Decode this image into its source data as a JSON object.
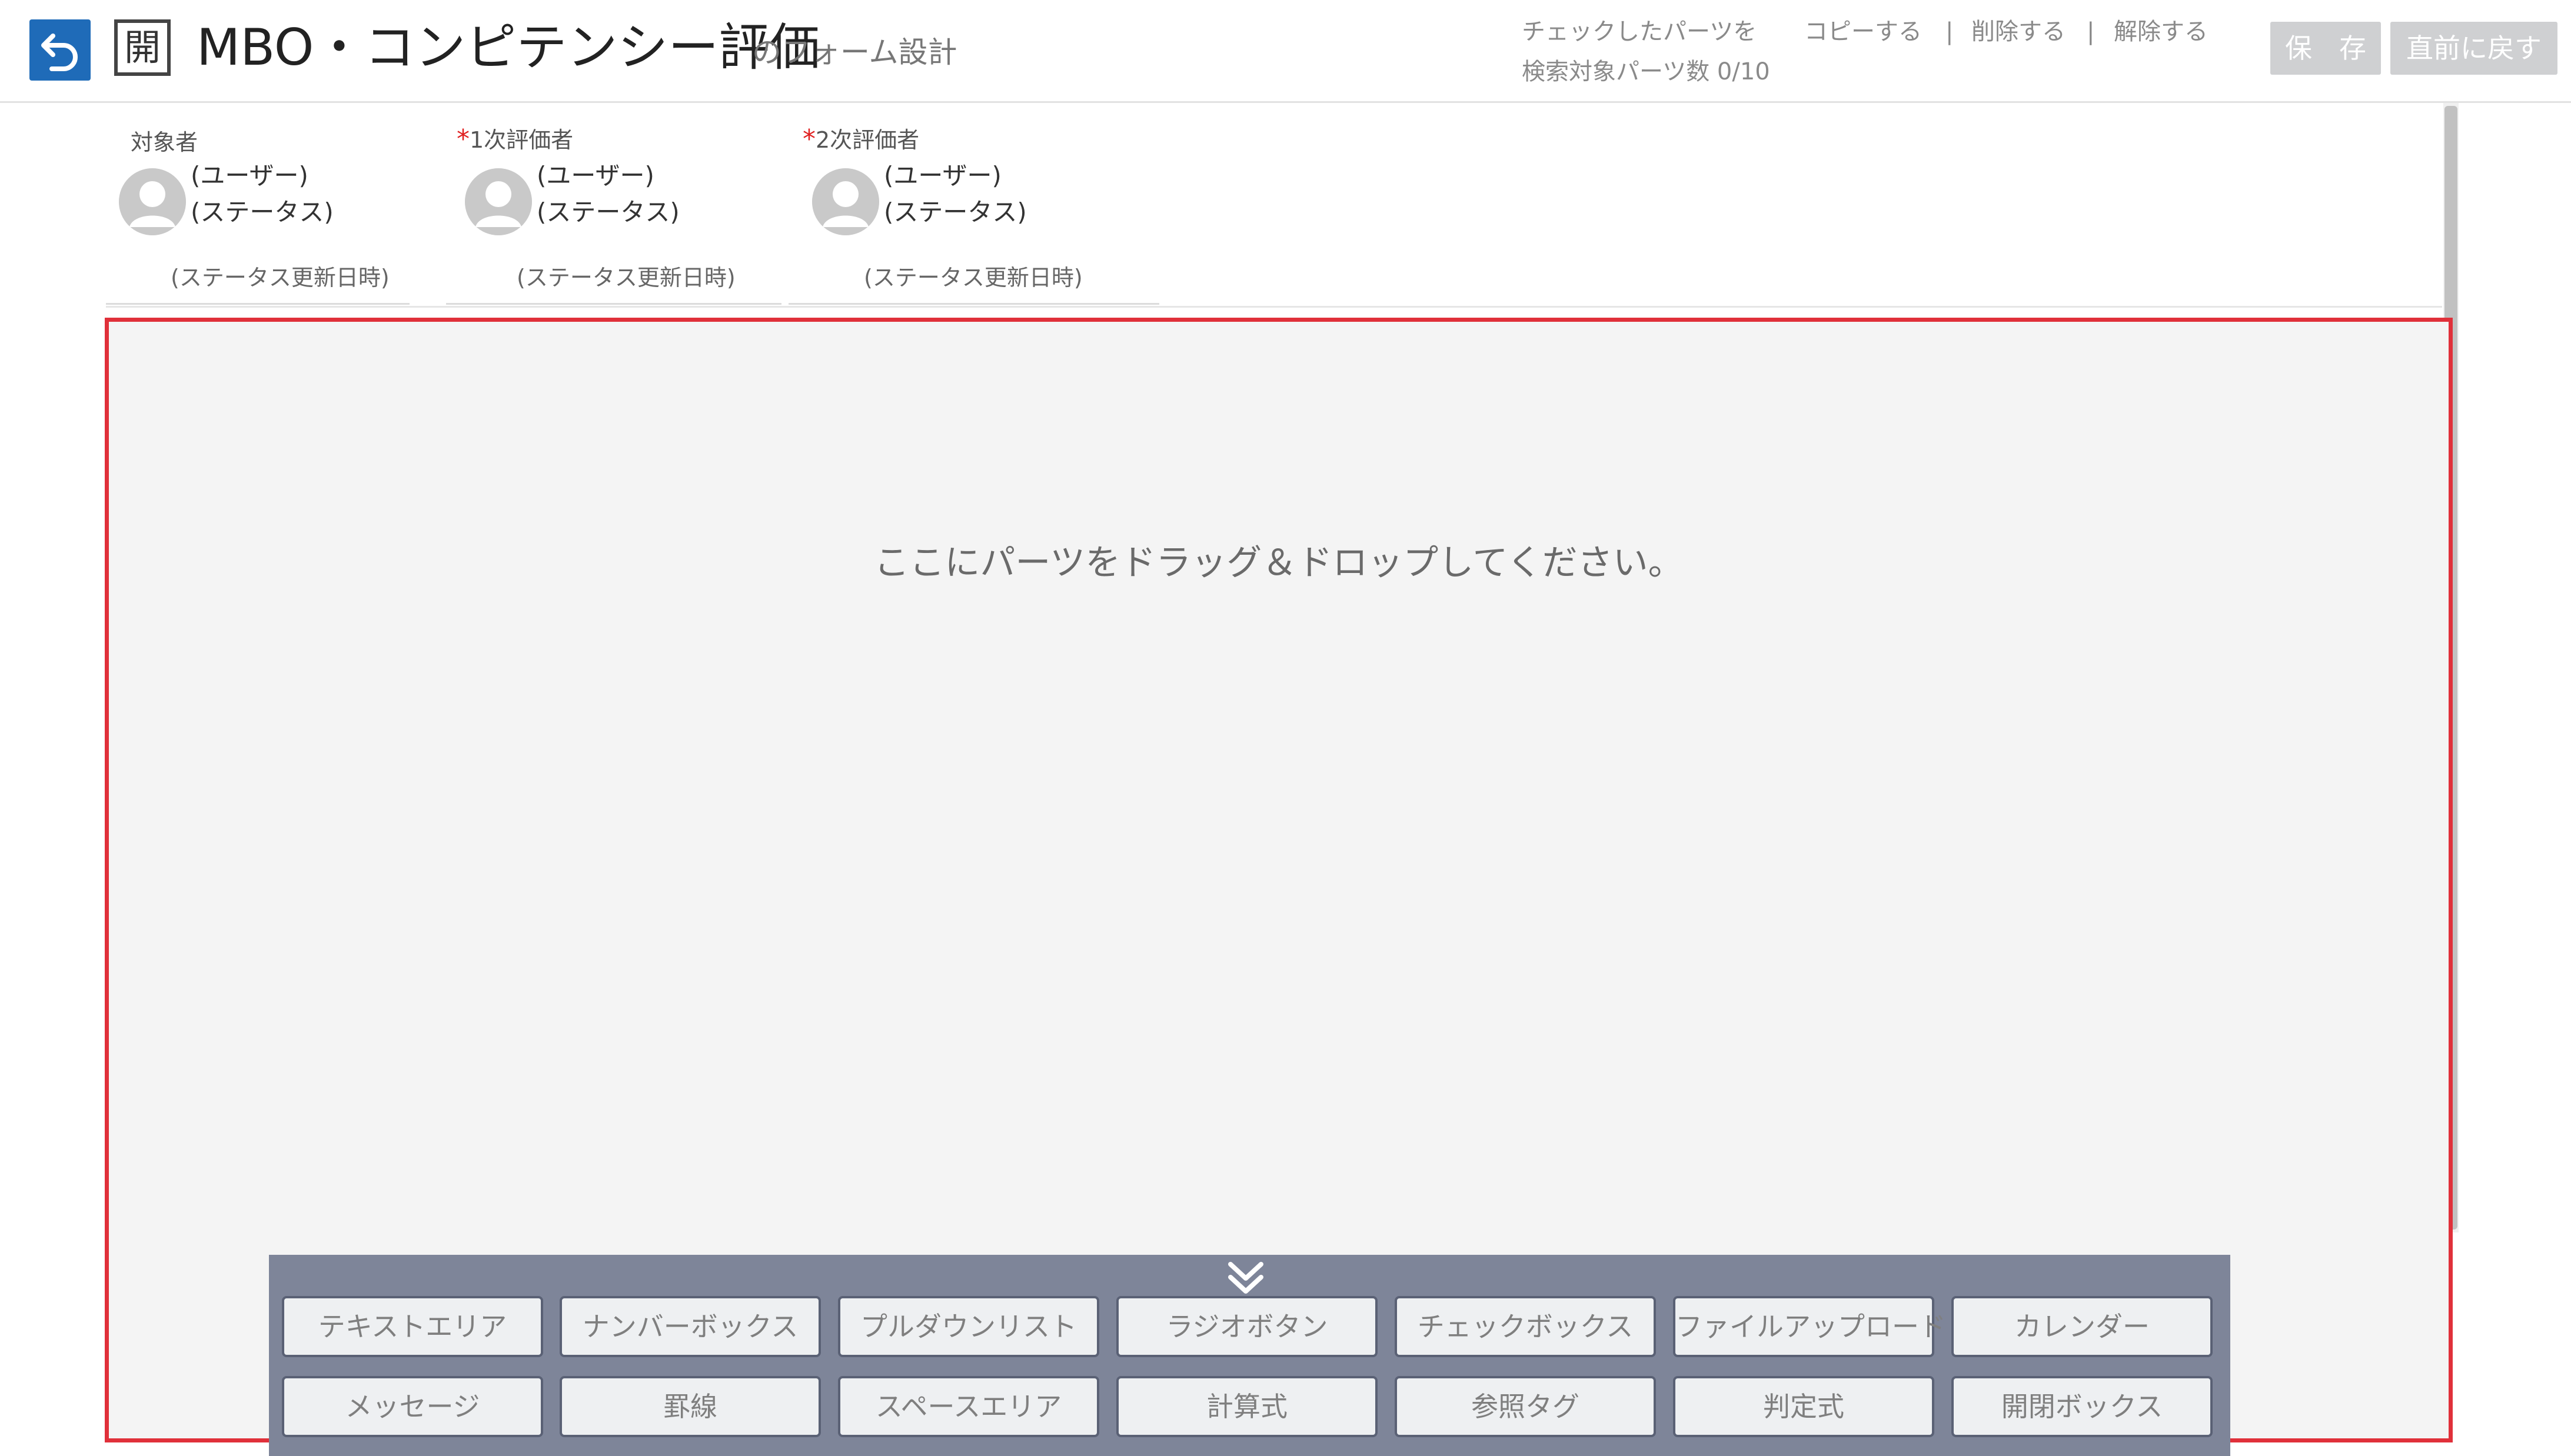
{
  "header": {
    "open_badge": "開",
    "title": "MBO・コンピテンシー評価",
    "subtitle": "のフォーム設計",
    "checked_parts_label": "チェックしたパーツを",
    "copy_link": "コピーする",
    "delete_link": "削除する",
    "release_link": "解除する",
    "separator": "|",
    "search_parts_count": "検索対象パーツ数 0/10",
    "save_button": "保　存",
    "revert_button": "直前に戻す"
  },
  "evaluators": [
    {
      "label": "対象者",
      "required": false,
      "required_mark": "",
      "user": "(ユーザー)",
      "status": "(ステータス)",
      "status_date": "(ステータス更新日時)"
    },
    {
      "label": "1次評価者",
      "required": true,
      "required_mark": "*",
      "user": "(ユーザー)",
      "status": "(ステータス)",
      "status_date": "(ステータス更新日時)"
    },
    {
      "label": "2次評価者",
      "required": true,
      "required_mark": "*",
      "user": "(ユーザー)",
      "status": "(ステータス)",
      "status_date": "(ステータス更新日時)"
    }
  ],
  "drop_zone": {
    "message": "ここにパーツをドラッグ＆ドロップしてください。"
  },
  "palette": {
    "toggle_icon": "double-chevron-down-icon",
    "rows": [
      [
        "テキストエリア",
        "ナンバーボックス",
        "プルダウンリスト",
        "ラジオボタン",
        "チェックボックス",
        "ファイルアップロード",
        "カレンダー"
      ],
      [
        "メッセージ",
        "罫線",
        "スペースエリア",
        "計算式",
        "参照タグ",
        "判定式",
        "開閉ボックス"
      ]
    ]
  },
  "colors": {
    "accent": "#1f6bb8",
    "drop_zone_border": "#e0303a",
    "palette_bg": "#7e8599",
    "required": "#e02020"
  }
}
